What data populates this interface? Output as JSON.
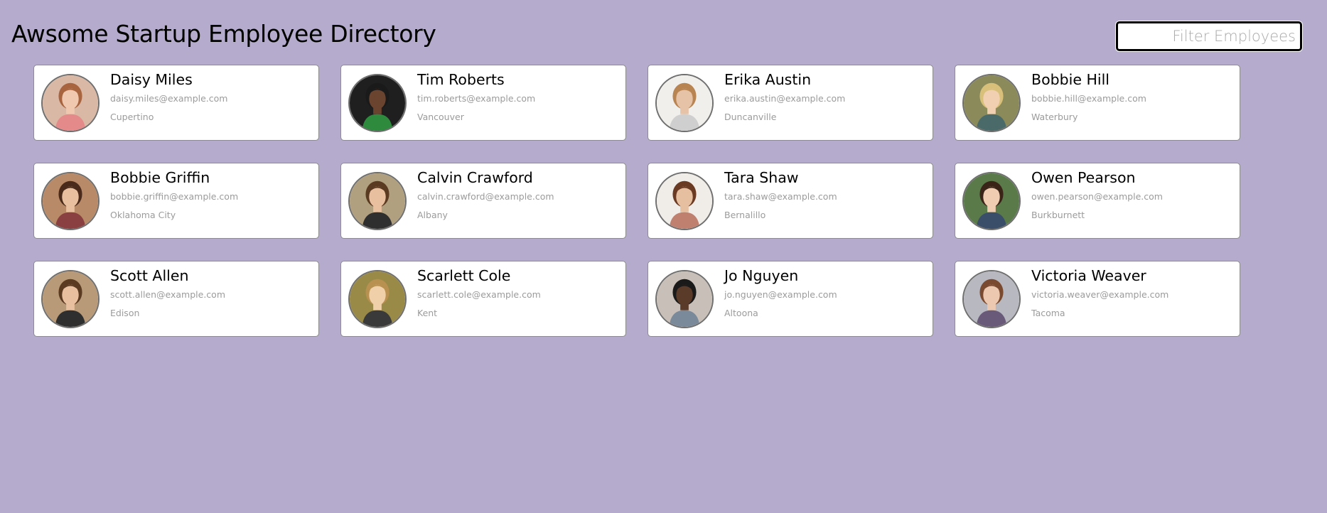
{
  "header": {
    "title": "Awsome Startup Employee Directory"
  },
  "search": {
    "placeholder": "Filter Employees",
    "value": ""
  },
  "employees": [
    {
      "name": "Daisy Miles",
      "email": "daisy.miles@example.com",
      "city": "Cupertino",
      "avatar": {
        "bg": "#d9b8a6",
        "skin": "#f0c8b0",
        "hair": "#a8643f",
        "shirt": "#e58a8a"
      }
    },
    {
      "name": "Tim Roberts",
      "email": "tim.roberts@example.com",
      "city": "Vancouver",
      "avatar": {
        "bg": "#1f1f1f",
        "skin": "#6b4430",
        "hair": "#1a1a1a",
        "shirt": "#2e8b3e"
      }
    },
    {
      "name": "Erika Austin",
      "email": "erika.austin@example.com",
      "city": "Duncanville",
      "avatar": {
        "bg": "#f1efec",
        "skin": "#e6c2a6",
        "hair": "#b88552",
        "shirt": "#cfcfcf"
      }
    },
    {
      "name": "Bobbie Hill",
      "email": "bobbie.hill@example.com",
      "city": "Waterbury",
      "avatar": {
        "bg": "#8a8a5a",
        "skin": "#f0d0b0",
        "hair": "#d8c07a",
        "shirt": "#4a6a6a"
      }
    },
    {
      "name": "Bobbie Griffin",
      "email": "bobbie.griffin@example.com",
      "city": "Oklahoma City",
      "avatar": {
        "bg": "#b88a68",
        "skin": "#e8c0a0",
        "hair": "#4a2a1a",
        "shirt": "#8a4040"
      }
    },
    {
      "name": "Calvin Crawford",
      "email": "calvin.crawford@example.com",
      "city": "Albany",
      "avatar": {
        "bg": "#b0a080",
        "skin": "#e8c0a0",
        "hair": "#5a3a20",
        "shirt": "#2f2f2f"
      }
    },
    {
      "name": "Tara Shaw",
      "email": "tara.shaw@example.com",
      "city": "Bernalillo",
      "avatar": {
        "bg": "#f0ece8",
        "skin": "#e6bfa0",
        "hair": "#6a3a22",
        "shirt": "#c08070"
      }
    },
    {
      "name": "Owen Pearson",
      "email": "owen.pearson@example.com",
      "city": "Burkburnett",
      "avatar": {
        "bg": "#5a7a4a",
        "skin": "#f0ccb0",
        "hair": "#3a2418",
        "shirt": "#3a4e6a"
      }
    },
    {
      "name": "Scott Allen",
      "email": "scott.allen@example.com",
      "city": "Edison",
      "avatar": {
        "bg": "#b89a78",
        "skin": "#e8c0a0",
        "hair": "#5a3a20",
        "shirt": "#2f2f2f"
      }
    },
    {
      "name": "Scarlett Cole",
      "email": "scarlett.cole@example.com",
      "city": "Kent",
      "avatar": {
        "bg": "#9a8a48",
        "skin": "#f0d0a8",
        "hair": "#b89050",
        "shirt": "#3a3a3a"
      }
    },
    {
      "name": "Jo Nguyen",
      "email": "jo.nguyen@example.com",
      "city": "Altoona",
      "avatar": {
        "bg": "#c8c0b8",
        "skin": "#5a3a28",
        "hair": "#1a1a1a",
        "shirt": "#7a8a9a"
      }
    },
    {
      "name": "Victoria Weaver",
      "email": "victoria.weaver@example.com",
      "city": "Tacoma",
      "avatar": {
        "bg": "#b8b8c0",
        "skin": "#ecc8b0",
        "hair": "#7a4a30",
        "shirt": "#6a5a7a"
      }
    }
  ]
}
